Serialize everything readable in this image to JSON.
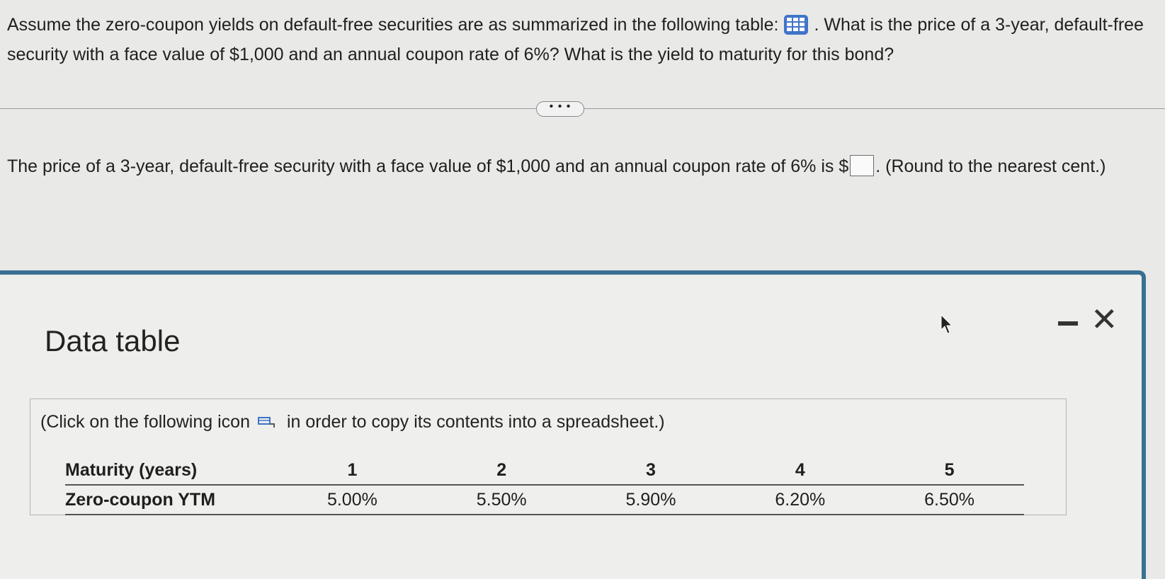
{
  "question": {
    "part1": "Assume the zero-coupon yields on default-free securities are as summarized in the following table:",
    "part2": ". What is the price of a 3-year, default-free security with a face value of $1,000 and an annual coupon rate of 6%? What is the yield to maturity for this bond?"
  },
  "more_button_label": "• • •",
  "answer": {
    "prefix": "The price of a 3-year, default-free security with a face value of $1,000 and an annual coupon rate of 6% is $",
    "input_value": "",
    "suffix": ". (Round to the nearest cent.)"
  },
  "popup": {
    "title": "Data table",
    "minimize_label": "",
    "close_label": "✕",
    "instruction_before": "(Click on the following icon",
    "instruction_after": "in order to copy its contents into a spreadsheet.)",
    "table": {
      "header_label": "Maturity (years)",
      "row_label": "Zero-coupon YTM",
      "maturities": [
        "1",
        "2",
        "3",
        "4",
        "5"
      ],
      "yields": [
        "5.00%",
        "5.50%",
        "5.90%",
        "6.20%",
        "6.50%"
      ]
    }
  },
  "colors": {
    "accent_blue": "#3f74c9",
    "popup_border": "#3a6f93",
    "background": "#e9e9e7"
  },
  "icons": [
    "table-grid-icon",
    "copy-spreadsheet-icon",
    "mouse-cursor-icon",
    "minimize-icon",
    "close-icon"
  ]
}
